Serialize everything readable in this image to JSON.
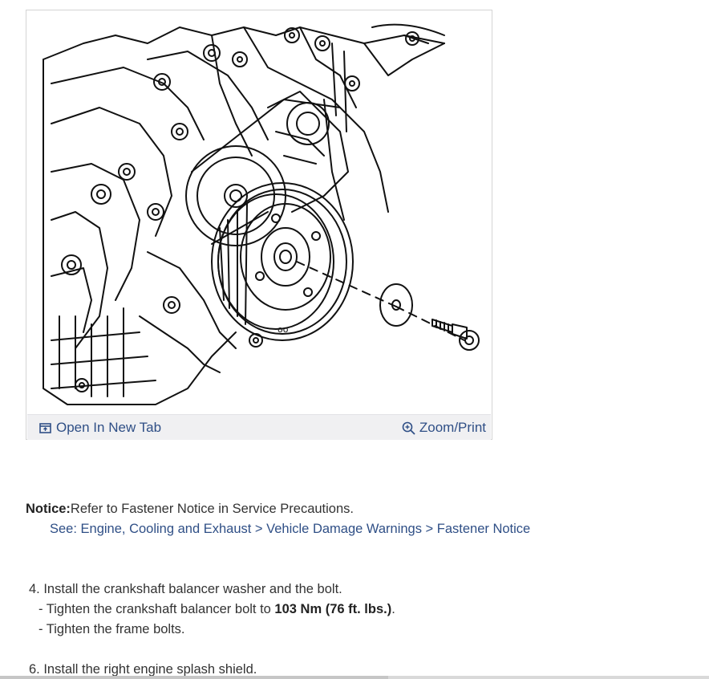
{
  "figure": {
    "open_tab_label": "Open In New Tab",
    "zoom_label": "Zoom/Print",
    "open_icon": "open-in-new-tab-icon",
    "zoom_icon": "zoom-in-icon"
  },
  "notice": {
    "label": "Notice:",
    "text": "Refer to Fastener Notice in Service Precautions.",
    "see_link": "See: Engine, Cooling and Exhaust > Vehicle Damage Warnings > Fastener Notice"
  },
  "steps": [
    {
      "text": "4. Install the crankshaft balancer washer and the bolt.",
      "sub": [
        {
          "before": "- Tighten the crankshaft balancer bolt to ",
          "bold": "103 Nm (76 ft. lbs.)",
          "after": "."
        },
        {
          "text": "- Tighten the frame bolts."
        }
      ]
    },
    {
      "text": "6. Install the right engine splash shield."
    }
  ],
  "colors": {
    "link": "#2f4f86",
    "toolbar_bg": "#f0f0f2",
    "text": "#333333"
  }
}
